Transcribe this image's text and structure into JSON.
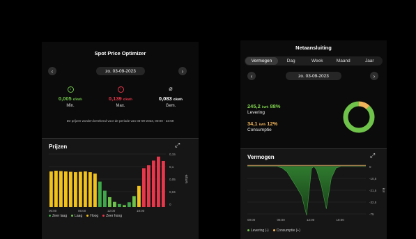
{
  "spot": {
    "title": "Spot Price Optimizer",
    "date": "zo. 03-09-2023",
    "min": {
      "value": "0,005",
      "unit": "€/kWh",
      "label": "Min."
    },
    "max": {
      "value": "0,139",
      "unit": "€/kWh",
      "label": "Max."
    },
    "avg": {
      "value": "0,083",
      "unit": "€/kWh",
      "label": "Gem."
    },
    "note": "De prijzen worden berekend voor de periode van 03-09-2023, 00:00 - 23:59",
    "chart_title": "Prijzen",
    "legend": [
      "Zeer laag",
      "Laag",
      "Hoog",
      "Zeer hoog"
    ],
    "colors": {
      "zeer_laag": "#3ea84a",
      "laag": "#6fc34a",
      "hoog": "#f2c21b",
      "zeer_hoog": "#e8374a"
    }
  },
  "net": {
    "title": "Netaansluiting",
    "tabs": [
      "Vermogen",
      "Dag",
      "Week",
      "Maand",
      "Jaar"
    ],
    "date": "zo. 03-09-2023",
    "levering": {
      "value": "245,2",
      "unit": "kWh",
      "pct": "88%",
      "label": "Levering"
    },
    "consumptie": {
      "value": "34,1",
      "unit": "kWh",
      "pct": "12%",
      "label": "Consumptie"
    },
    "donut": {
      "levering_fraction": 0.88,
      "consumptie_fraction": 0.12,
      "levering_color": "#6fc34a",
      "consumptie_color": "#f0b35a"
    },
    "chart_title": "Vermogen",
    "legend": [
      "Levering (-)",
      "Consumptie (+)"
    ]
  },
  "chart_data": [
    {
      "type": "bar",
      "title": "Prijzen",
      "ylabel": "€/kWh",
      "x_ticks": [
        "00:00",
        "06:00",
        "12:00",
        "18:00"
      ],
      "y_ticks": [
        "0,15",
        "0,1",
        "0,05",
        "0,04",
        "0"
      ],
      "ylim": [
        0,
        0.15
      ],
      "hours": [
        0,
        1,
        2,
        3,
        4,
        5,
        6,
        7,
        8,
        9,
        10,
        11,
        12,
        13,
        14,
        15,
        16,
        17,
        18,
        19,
        20,
        21,
        22,
        23
      ],
      "values": [
        0.098,
        0.1,
        0.099,
        0.098,
        0.097,
        0.096,
        0.097,
        0.098,
        0.096,
        0.092,
        0.07,
        0.045,
        0.027,
        0.014,
        0.008,
        0.005,
        0.013,
        0.03,
        0.058,
        0.107,
        0.115,
        0.128,
        0.139,
        0.127
      ],
      "categories": [
        "hoog",
        "hoog",
        "hoog",
        "hoog",
        "hoog",
        "hoog",
        "hoog",
        "hoog",
        "hoog",
        "hoog",
        "zeer_laag",
        "zeer_laag",
        "laag",
        "laag",
        "zeer_laag",
        "laag",
        "zeer_laag",
        "laag",
        "hoog",
        "zeer_hoog",
        "zeer_hoog",
        "zeer_hoog",
        "zeer_hoog",
        "zeer_hoog"
      ]
    },
    {
      "type": "area",
      "title": "Vermogen",
      "ylabel": "kW",
      "x_ticks": [
        "00:00",
        "06:00",
        "12:00",
        "18:00"
      ],
      "y_ticks": [
        "0",
        "-10,5",
        "-21,5",
        "-32,5",
        "-75"
      ],
      "series": [
        {
          "name": "Levering (-)",
          "x": [
            0,
            6,
            7,
            8,
            9,
            10,
            11,
            12,
            13,
            13.5,
            14,
            15,
            16,
            17,
            18,
            19,
            24
          ],
          "y": [
            0,
            0,
            -2,
            -8,
            -20,
            -32,
            -45,
            -75,
            -3,
            0,
            -5,
            -30,
            -65,
            -18,
            -2,
            0,
            0
          ]
        },
        {
          "name": "Consumptie (+)",
          "x": [
            0,
            24
          ],
          "y": [
            0.5,
            0.5
          ]
        }
      ]
    }
  ]
}
